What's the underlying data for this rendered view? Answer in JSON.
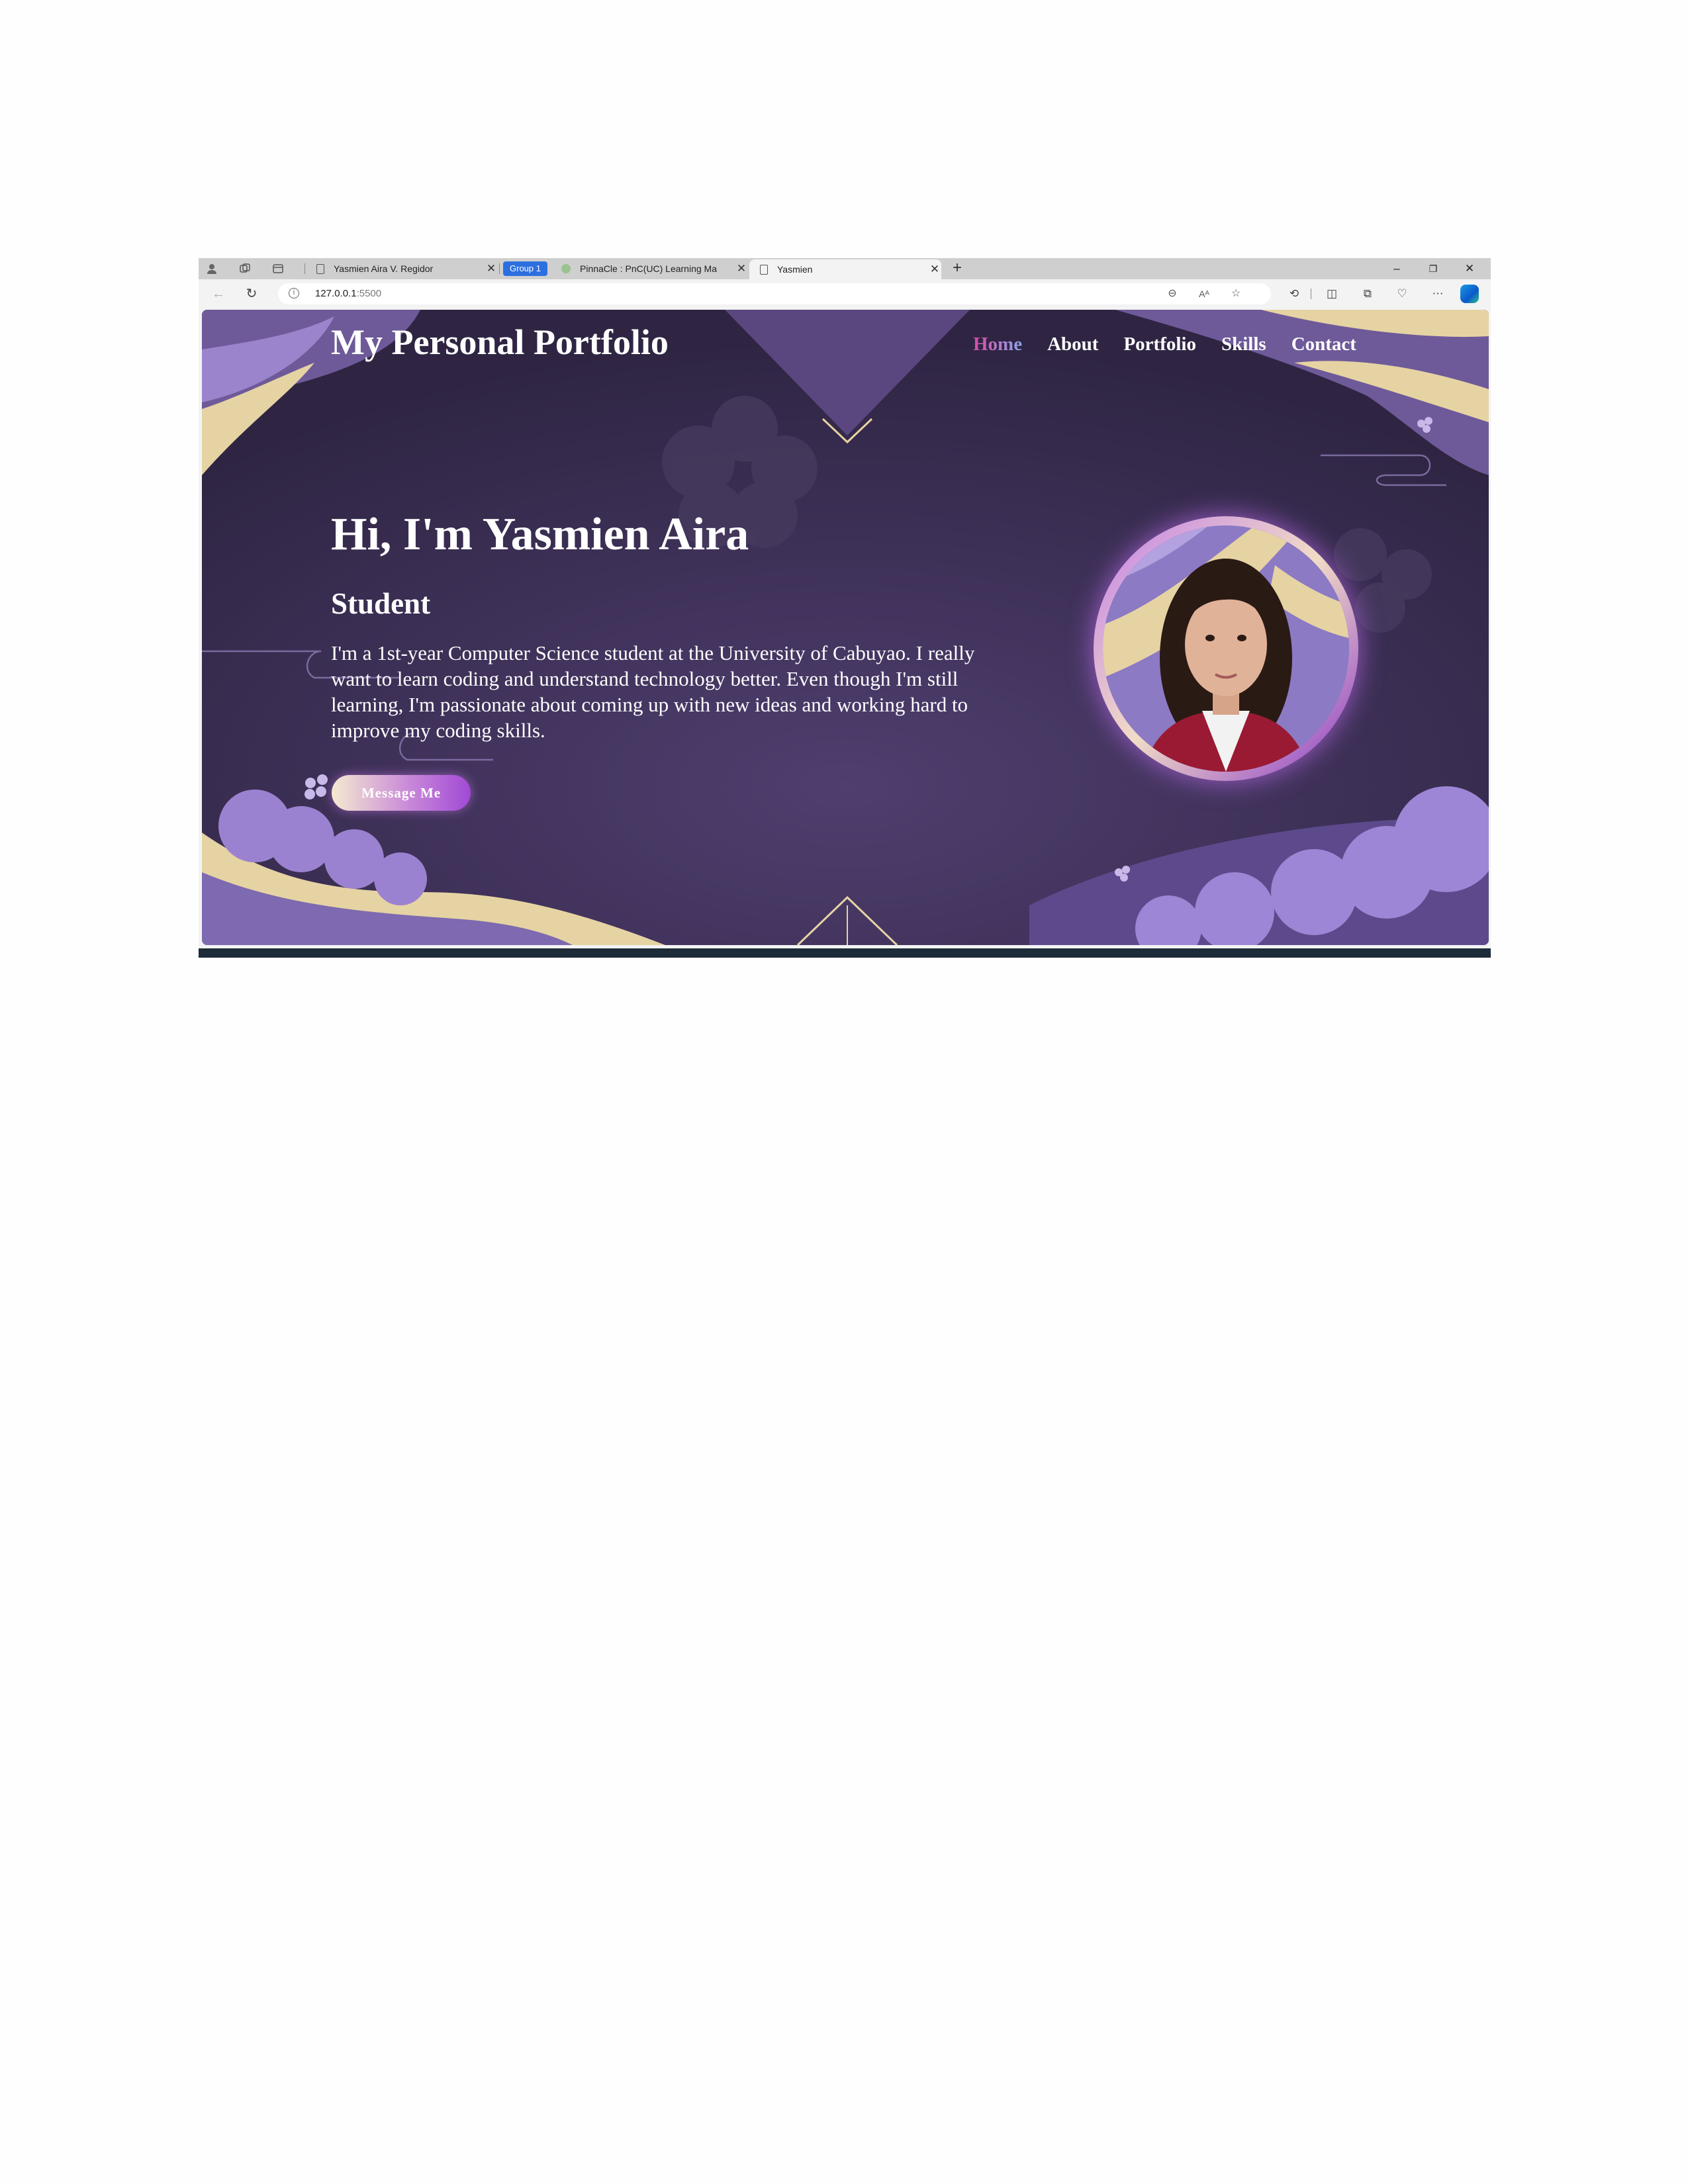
{
  "browser": {
    "tabs": [
      {
        "title": "Yasmien Aira V. Regidor",
        "active": false
      },
      {
        "title": "PinnaCle : PnC(UC) Learning Ma",
        "active": false
      },
      {
        "title": "Yasmien",
        "active": true
      }
    ],
    "tab_group_label": "Group 1",
    "address": {
      "host": "127.0.0.1",
      "port": ":5500"
    }
  },
  "site": {
    "title": "My Personal Portfolio",
    "nav": [
      {
        "label": "Home",
        "active": true
      },
      {
        "label": "About"
      },
      {
        "label": "Portfolio"
      },
      {
        "label": "Skills"
      },
      {
        "label": "Contact"
      }
    ]
  },
  "hero": {
    "heading": "Hi, I'm Yasmien Aira",
    "subheading": "Student",
    "description": "I'm a 1st-year Computer Science student at the University of Cabuyao. I really want to learn coding and understand technology better. Even though I'm still learning, I'm passionate about coming up with new ideas and working hard to improve my coding skills.",
    "button_label": "Message Me"
  },
  "colors": {
    "background": "#332848",
    "accent_purple": "#a149d6",
    "gold": "#e6d3a3",
    "nav_active_start": "#d84aa6",
    "nav_active_end": "#8aa6e8"
  },
  "icons": [
    "profile-icon",
    "workspaces-icon",
    "tab-actions-icon",
    "page-icon",
    "close-icon",
    "new-tab-icon",
    "minimize-icon",
    "restore-icon",
    "back-icon",
    "refresh-icon",
    "info-icon",
    "zoom-out-icon",
    "read-aloud-icon",
    "favorite-icon",
    "extensions-icon",
    "split-screen-icon",
    "collections-icon",
    "performance-icon",
    "more-icon",
    "copilot-icon"
  ]
}
